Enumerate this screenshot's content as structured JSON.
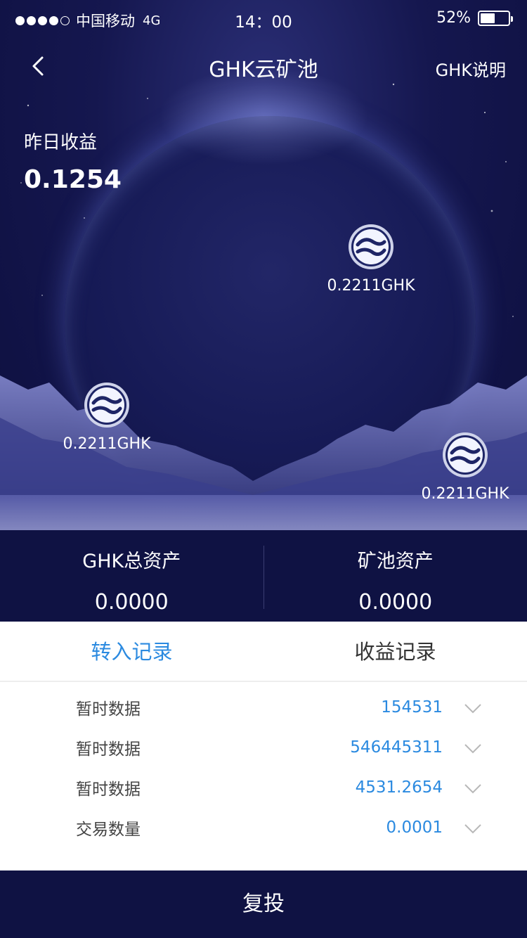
{
  "status_bar": {
    "carrier": "中国移动",
    "network": "4G",
    "time": "14：00",
    "battery": "52%",
    "battery_level": 0.52
  },
  "nav": {
    "title": "GHK云矿池",
    "right_link": "GHK说明"
  },
  "yesterday": {
    "label": "昨日收益",
    "value": "0.1254"
  },
  "coins": [
    {
      "amount": "0.2211GHK"
    },
    {
      "amount": "0.2211GHK"
    },
    {
      "amount": "0.2211GHK"
    }
  ],
  "assets": {
    "total_label": "GHK总资产",
    "total_value": "0.0000",
    "pool_label": "矿池资产",
    "pool_value": "0.0000"
  },
  "tabs": [
    {
      "label": "转入记录",
      "active": true
    },
    {
      "label": "收益记录",
      "active": false
    }
  ],
  "records": [
    {
      "label": "暂时数据",
      "value": "154531"
    },
    {
      "label": "暂时数据",
      "value": "546445311"
    },
    {
      "label": "暂时数据",
      "value": "4531.2654"
    },
    {
      "label": "交易数量",
      "value": "0.0001"
    }
  ],
  "footer": {
    "button_label": "复投"
  },
  "colors": {
    "accent": "#2b8ae0",
    "dark_navy": "#0f1243"
  }
}
